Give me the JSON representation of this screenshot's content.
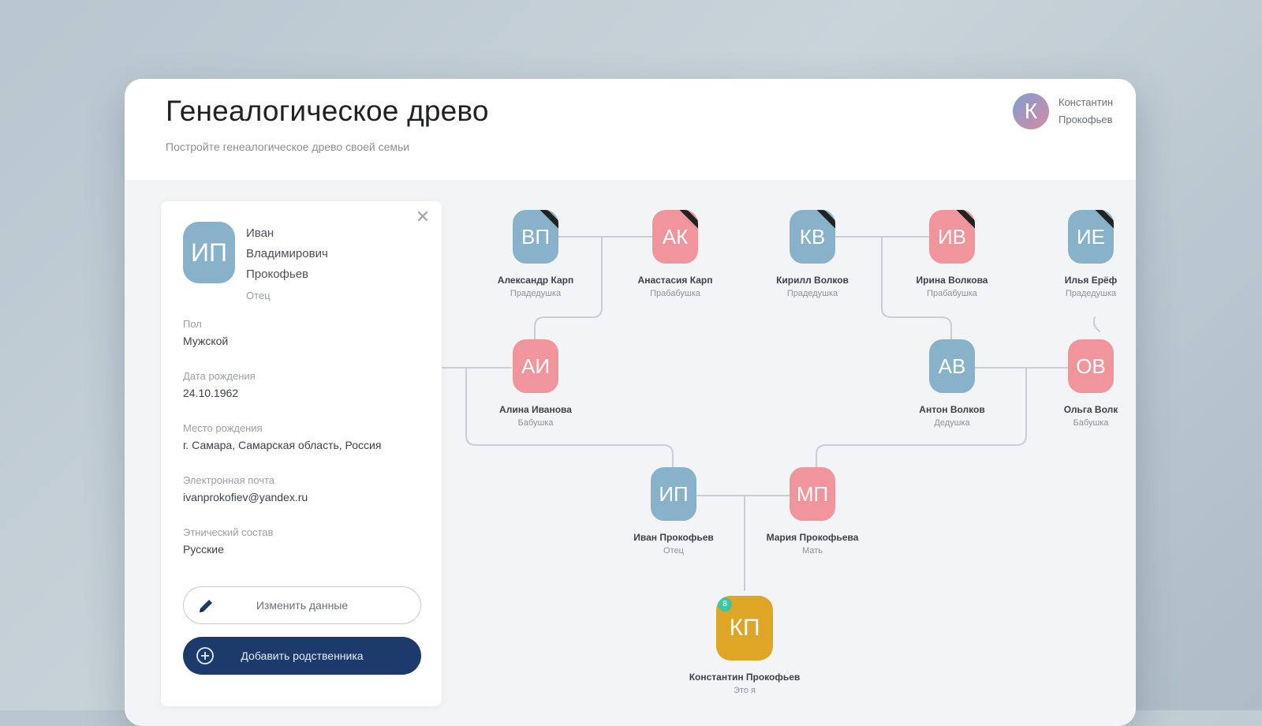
{
  "header": {
    "title": "Генеалогическое древо",
    "subtitle": "Постройте генеалогическое древо своей семьи"
  },
  "user": {
    "initial": "К",
    "first_name": "Константин",
    "last_name": "Прокофьев"
  },
  "details": {
    "initials": "ИП",
    "name_line1": "Иван",
    "name_line2": "Владимирович",
    "name_line3": "Прокофьев",
    "role": "Отец",
    "fields": [
      {
        "label": "Пол",
        "value": "Мужской"
      },
      {
        "label": "Дата рождения",
        "value": "24.10.1962"
      },
      {
        "label": "Место рождения",
        "value": "г. Самара, Самарская область, Россия"
      },
      {
        "label": "Электронная почта",
        "value": "ivanprokofiev@yandex.ru"
      },
      {
        "label": "Этнический состав",
        "value": "Русские"
      }
    ],
    "edit_label": "Изменить данные",
    "add_label": "Добавить родственника",
    "close_symbol": "✕"
  },
  "tree": {
    "nodes": [
      {
        "id": "vp",
        "initials": "ВП",
        "name": "Александр Карп",
        "role": "Прадедушка",
        "gender": "male",
        "deceased": true
      },
      {
        "id": "ak",
        "initials": "АК",
        "name": "Анастасия Карп",
        "role": "Прабабушка",
        "gender": "female",
        "deceased": true
      },
      {
        "id": "kv",
        "initials": "КВ",
        "name": "Кирилл Волков",
        "role": "Прадедушка",
        "gender": "male",
        "deceased": true
      },
      {
        "id": "iv",
        "initials": "ИВ",
        "name": "Ирина Волкова",
        "role": "Прабабушка",
        "gender": "female",
        "deceased": true
      },
      {
        "id": "ie",
        "initials": "ИЕ",
        "name": "Илья Ерёф",
        "role": "Прадедушка",
        "gender": "male",
        "deceased": true
      },
      {
        "id": "ai",
        "initials": "АИ",
        "name": "Алина Иванова",
        "role": "Бабушка",
        "gender": "female",
        "deceased": false
      },
      {
        "id": "av",
        "initials": "АВ",
        "name": "Антон Волков",
        "role": "Дедушка",
        "gender": "male",
        "deceased": false
      },
      {
        "id": "ov",
        "initials": "ОВ",
        "name": "Ольга Волк",
        "role": "Бабушка",
        "gender": "female",
        "deceased": false
      },
      {
        "id": "ip",
        "initials": "ИП",
        "name": "Иван Прокофьев",
        "role": "Отец",
        "gender": "male",
        "deceased": false
      },
      {
        "id": "mp",
        "initials": "МП",
        "name": "Мария Прокофьева",
        "role": "Мать",
        "gender": "female",
        "deceased": false
      },
      {
        "id": "kp",
        "initials": "КП",
        "name": "Константин Прокофьев",
        "role": "Это я",
        "gender": "self",
        "deceased": false,
        "badge": "8"
      }
    ]
  },
  "colors": {
    "male": "#87b2c9",
    "female": "#f1959d",
    "self": "#dfa524",
    "primary_button": "#1c3a6c",
    "badge": "#3cc6a5"
  }
}
